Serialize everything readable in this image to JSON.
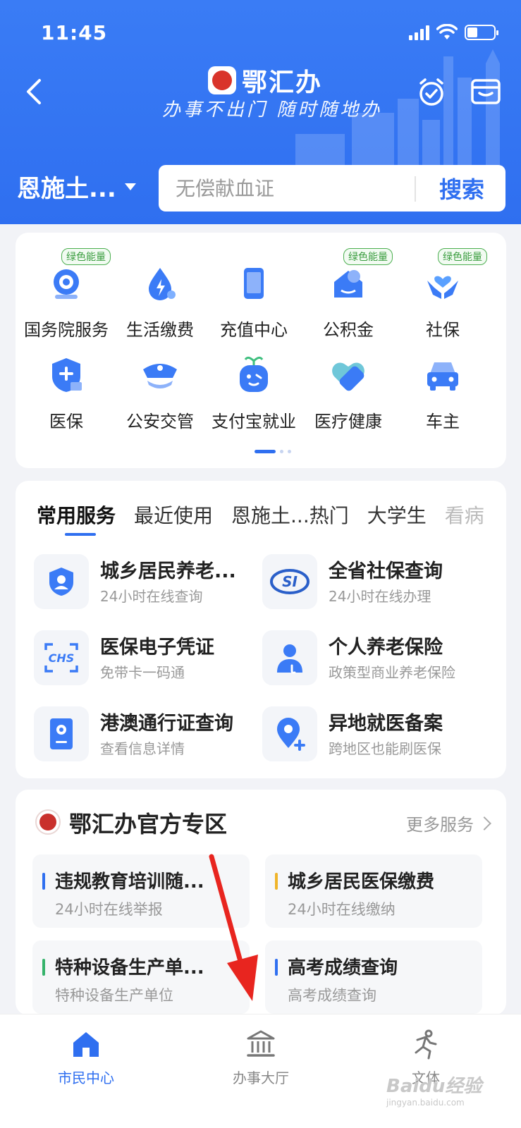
{
  "status_bar": {
    "time": "11:45"
  },
  "header": {
    "app_title": "鄂汇办",
    "slogan": "办事不出门 随时随地办",
    "city": "恩施土...",
    "search_placeholder": "无偿献血证",
    "search_button": "搜索"
  },
  "quick_grid": {
    "badge_label": "绿色能量",
    "items": [
      {
        "label": "国务院服务",
        "icon": "state-council-icon",
        "badge": true
      },
      {
        "label": "生活缴费",
        "icon": "utility-payment-icon",
        "badge": false
      },
      {
        "label": "充值中心",
        "icon": "phone-topup-icon",
        "badge": false
      },
      {
        "label": "公积金",
        "icon": "housing-fund-icon",
        "badge": true
      },
      {
        "label": "社保",
        "icon": "social-security-icon",
        "badge": true
      },
      {
        "label": "医保",
        "icon": "medical-insurance-icon",
        "badge": false
      },
      {
        "label": "公安交管",
        "icon": "police-cap-icon",
        "badge": false
      },
      {
        "label": "支付宝就业",
        "icon": "robot-sprout-icon",
        "badge": false
      },
      {
        "label": "医疗健康",
        "icon": "health-heart-icon",
        "badge": false
      },
      {
        "label": "车主",
        "icon": "car-icon",
        "badge": false
      }
    ]
  },
  "services": {
    "tabs": [
      "常用服务",
      "最近使用",
      "恩施土...热门",
      "大学生",
      "看病"
    ],
    "items": [
      {
        "title": "城乡居民养老...",
        "sub": "24小时在线查询",
        "icon": "pension-shield-icon"
      },
      {
        "title": "全省社保查询",
        "sub": "24小时在线办理",
        "icon": "si-logo-icon"
      },
      {
        "title": "医保电子凭证",
        "sub": "免带卡一码通",
        "icon": "chs-scan-icon"
      },
      {
        "title": "个人养老保险",
        "sub": "政策型商业养老保险",
        "icon": "person-insurance-icon"
      },
      {
        "title": "港澳通行证查询",
        "sub": "查看信息详情",
        "icon": "hk-permit-icon"
      },
      {
        "title": "异地就医备案",
        "sub": "跨地区也能刷医保",
        "icon": "location-plus-icon"
      }
    ]
  },
  "official": {
    "title": "鄂汇办官方专区",
    "more": "更多服务",
    "items": [
      {
        "title": "违规教育培训随...",
        "sub": "24小时在线举报",
        "color": "#2f6ff0"
      },
      {
        "title": "城乡居民医保缴费",
        "sub": "24小时在线缴纳",
        "color": "#f0b429"
      },
      {
        "title": "特种设备生产单...",
        "sub": "特种设备生产单位",
        "color": "#35b36b"
      },
      {
        "title": "高考成绩查询",
        "sub": "高考成绩查询",
        "color": "#2f6ff0"
      }
    ]
  },
  "tabbar": {
    "items": [
      {
        "label": "市民中心",
        "icon": "home-icon",
        "active": true
      },
      {
        "label": "办事大厅",
        "icon": "government-hall-icon",
        "active": false
      },
      {
        "label": "文体",
        "icon": "runner-icon",
        "active": false
      }
    ]
  },
  "watermark": {
    "brand": "Baidu经验",
    "url": "jingyan.baidu.com"
  },
  "colors": {
    "primary": "#2f6ff0",
    "badge_green": "#4caf50",
    "annotation_arrow": "#e8251f"
  }
}
